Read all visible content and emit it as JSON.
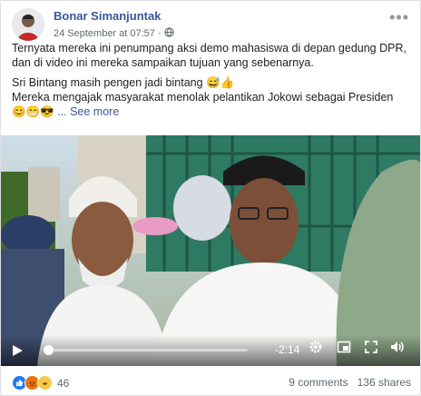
{
  "post": {
    "author": "Bonar Simanjuntak",
    "timestamp": "24 September at 07:57",
    "privacy_icon": "globe-icon",
    "text_lines": [
      "Ternyata mereka ini penumpang aksi demo mahasiswa di depan gedung DPR,",
      "dan di video ini mereka sampaikan tujuan yang sebenarnya.",
      "Sri Bintang masih pengen jadi bintang 😅👍",
      "Mereka mengajak masyarakat menolak pelantikan Jokowi sebagai Presiden",
      "😊😁😎"
    ],
    "see_more": "... See more"
  },
  "video": {
    "time_remaining": "-2:14",
    "progress": 0.02
  },
  "footer": {
    "reaction_count": "46",
    "comments": "9 comments",
    "shares": "136 shares"
  },
  "colors": {
    "link": "#385898",
    "like": "#2078f4",
    "angry": "#e9710f",
    "haha": "#f7c948"
  }
}
